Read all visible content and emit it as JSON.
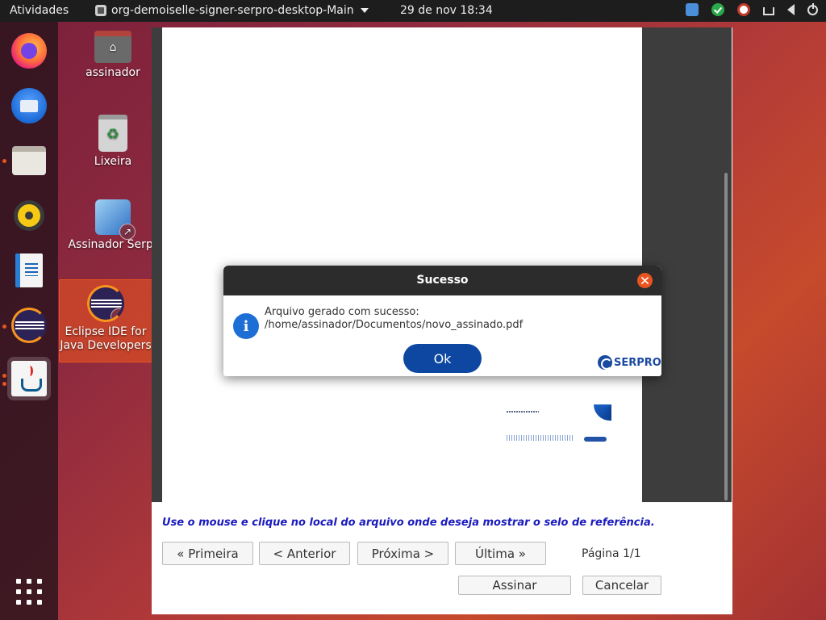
{
  "topbar": {
    "activities": "Atividades",
    "app_name": "org-demoiselle-signer-serpro-desktop-Main",
    "clock": "29 de nov  18:34",
    "tray_icons": [
      "screenshot-tool-icon",
      "check-status-icon",
      "serpro-status-icon",
      "network-icon",
      "volume-icon",
      "power-icon"
    ]
  },
  "dock": {
    "items": [
      "firefox-icon",
      "thunderbird-icon",
      "files-icon",
      "rhythmbox-icon",
      "writer-icon",
      "eclipse-icon",
      "java-icon"
    ],
    "show_apps": "show-apps-icon"
  },
  "desktop": {
    "icons": [
      {
        "label": "assinador",
        "icon": "home-folder-icon"
      },
      {
        "label": "Lixeira",
        "icon": "trash-icon"
      },
      {
        "label": "Assinador Serpr",
        "icon": "signer-icon"
      },
      {
        "label_line1": "Eclipse IDE for",
        "label_line2": "Java Developers",
        "icon": "eclipse-icon"
      }
    ]
  },
  "app": {
    "instruction": "Use o mouse e clique no local do arquivo onde deseja mostrar o selo de referência.",
    "nav": {
      "first": "«  Primeira",
      "prev": "<  Anterior",
      "next": "Próxima  >",
      "last": "Última  »"
    },
    "page_indicator": "Página 1/1",
    "sign": "Assinar",
    "cancel": "Cancelar"
  },
  "dialog": {
    "title": "Sucesso",
    "message_line1": "Arquivo gerado com sucesso:",
    "message_line2": "/home/assinador/Documentos/novo_assinado.pdf",
    "ok": "Ok",
    "brand": "SERPRO",
    "info_glyph": "i"
  },
  "colors": {
    "accent": "#e95420",
    "dialog_button": "#0d47a1",
    "instruction_text": "#1b1bbf"
  }
}
